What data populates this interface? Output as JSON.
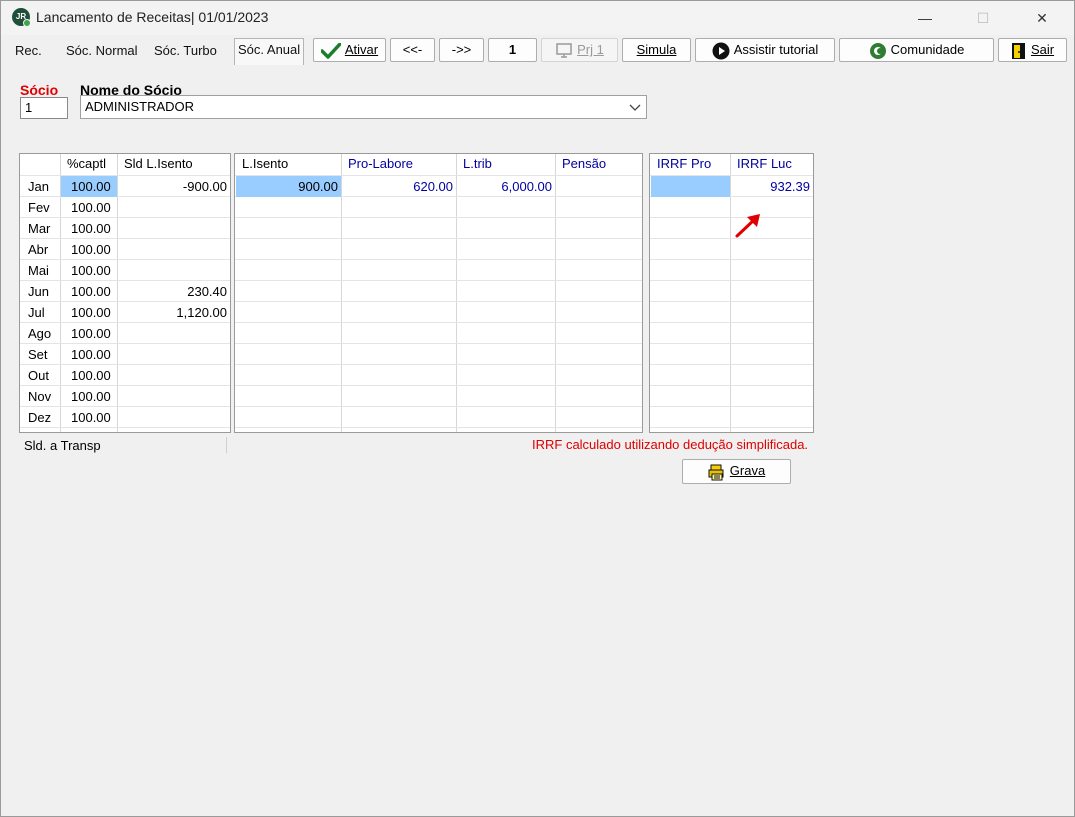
{
  "window": {
    "app_icon_text": "JR",
    "title": "Lancamento de Receitas|  01/01/2023",
    "minimize": "—",
    "maximize": "☐",
    "close": "✕"
  },
  "tabs": [
    {
      "label": "Rec."
    },
    {
      "label": "Sóc. Normal"
    },
    {
      "label": "Sóc. Turbo"
    },
    {
      "label": "Sóc. Anual",
      "active": true
    }
  ],
  "toolbar": {
    "ativar": "Ativar",
    "prev": "<<-",
    "next": "->>",
    "page": "1",
    "prj": "Prj 1",
    "simula": "Simula",
    "tutorial": "Assistir tutorial",
    "comunidade": "Comunidade",
    "sair": "Sair"
  },
  "form": {
    "socio_label": "Sócio",
    "socio_value": "1",
    "nome_label": "Nome do Sócio",
    "nome_value": "ADMINISTRADOR"
  },
  "grid1": {
    "headers": [
      "",
      "%captl",
      "Sld L.Isento"
    ],
    "rows": [
      [
        "Jan",
        "100.00",
        "-900.00"
      ],
      [
        "Fev",
        "100.00",
        ""
      ],
      [
        "Mar",
        "100.00",
        ""
      ],
      [
        "Abr",
        "100.00",
        ""
      ],
      [
        "Mai",
        "100.00",
        ""
      ],
      [
        "Jun",
        "100.00",
        "230.40"
      ],
      [
        "Jul",
        "100.00",
        "1,120.00"
      ],
      [
        "Ago",
        "100.00",
        ""
      ],
      [
        "Set",
        "100.00",
        ""
      ],
      [
        "Out",
        "100.00",
        ""
      ],
      [
        "Nov",
        "100.00",
        ""
      ],
      [
        "Dez",
        "100.00",
        ""
      ]
    ]
  },
  "grid2": {
    "headers": [
      "L.Isento",
      "Pro-Labore",
      "L.trib",
      "Pensão"
    ],
    "rows": [
      [
        "900.00",
        "620.00",
        "6,000.00",
        ""
      ],
      [
        "",
        "",
        "",
        ""
      ],
      [
        "",
        "",
        "",
        ""
      ],
      [
        "",
        "",
        "",
        ""
      ],
      [
        "",
        "",
        "",
        ""
      ],
      [
        "",
        "",
        "",
        ""
      ],
      [
        "",
        "",
        "",
        ""
      ],
      [
        "",
        "",
        "",
        ""
      ],
      [
        "",
        "",
        "",
        ""
      ],
      [
        "",
        "",
        "",
        ""
      ],
      [
        "",
        "",
        "",
        ""
      ],
      [
        "",
        "",
        "",
        ""
      ]
    ]
  },
  "grid3": {
    "headers": [
      "IRRF Pro",
      "IRRF Luc"
    ],
    "rows": [
      [
        "",
        "932.39"
      ],
      [
        "",
        ""
      ],
      [
        "",
        ""
      ],
      [
        "",
        ""
      ],
      [
        "",
        ""
      ],
      [
        "",
        ""
      ],
      [
        "",
        ""
      ],
      [
        "",
        ""
      ],
      [
        "",
        ""
      ],
      [
        "",
        ""
      ],
      [
        "",
        ""
      ],
      [
        "",
        ""
      ]
    ]
  },
  "footer": {
    "sld_transp": "Sld. a Transp",
    "irrf_note": "IRRF calculado utilizando dedução simplificada.",
    "grava": "Grava"
  },
  "colors": {
    "highlight": "#99ccff",
    "blue_text": "#0000a0",
    "red_text": "#e00000",
    "arrow": "#e00000"
  }
}
